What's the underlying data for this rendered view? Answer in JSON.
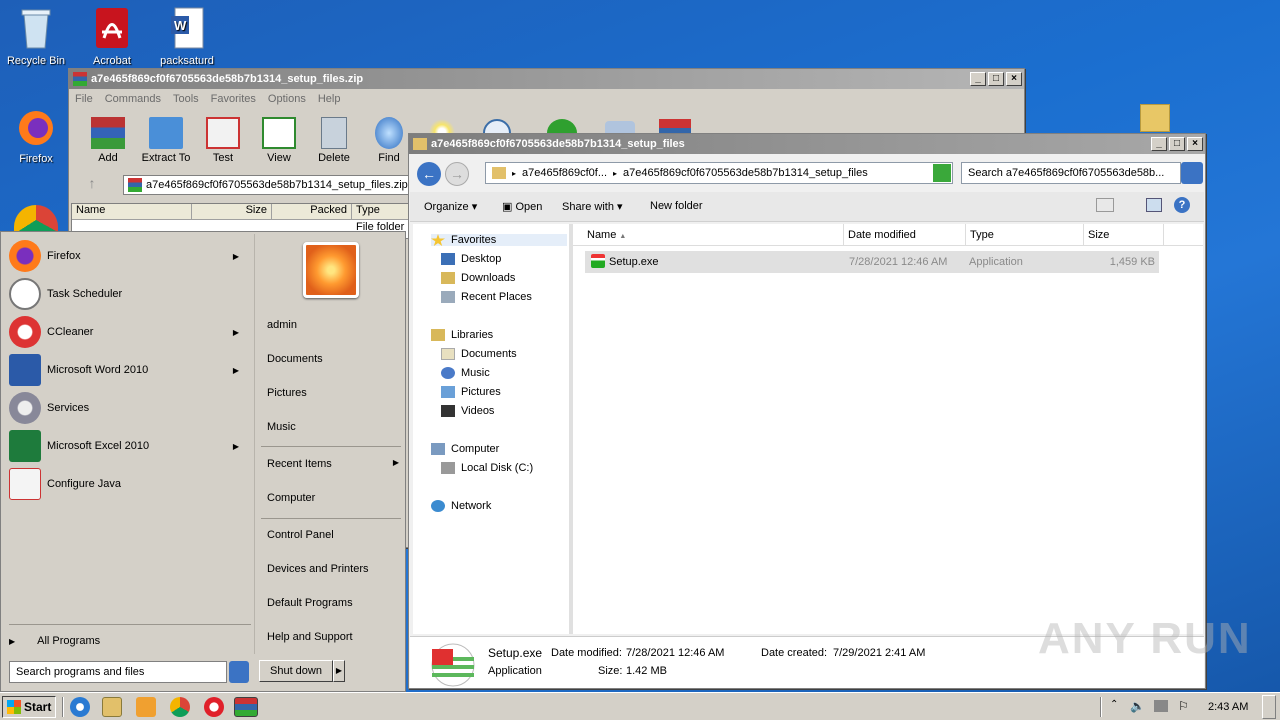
{
  "desktop": {
    "icons": [
      {
        "label": "Recycle Bin"
      },
      {
        "label": "Acrobat"
      },
      {
        "label": "packsaturd"
      },
      {
        "label": "Firefox"
      }
    ]
  },
  "winrar": {
    "title": "a7e465f869cf0f6705563de58b7b1314_setup_files.zip",
    "menu": [
      "File",
      "Commands",
      "Tools",
      "Favorites",
      "Options",
      "Help"
    ],
    "toolbar": [
      "Add",
      "Extract To",
      "Test",
      "View",
      "Delete",
      "Find"
    ],
    "path": "a7e465f869cf0f6705563de58b7b1314_setup_files.zip",
    "columns": [
      "Name",
      "Size",
      "Packed",
      "Type"
    ],
    "row_type": "File folder"
  },
  "explorer": {
    "title": "a7e465f869cf0f6705563de58b7b1314_setup_files",
    "crumb1": "a7e465f869cf0f...",
    "crumb2": "a7e465f869cf0f6705563de58b7b1314_setup_files",
    "search_placeholder": "Search a7e465f869cf0f6705563de58b...",
    "commands": {
      "organize": "Organize",
      "open": "Open",
      "share": "Share with",
      "new_folder": "New folder"
    },
    "nav": {
      "favorites": "Favorites",
      "desktop": "Desktop",
      "downloads": "Downloads",
      "recent": "Recent Places",
      "libraries": "Libraries",
      "documents": "Documents",
      "music": "Music",
      "pictures": "Pictures",
      "videos": "Videos",
      "computer": "Computer",
      "localdisk": "Local Disk (C:)",
      "network": "Network"
    },
    "columns": {
      "name": "Name",
      "date": "Date modified",
      "type": "Type",
      "size": "Size"
    },
    "file": {
      "name": "Setup.exe",
      "date": "7/28/2021 12:46 AM",
      "type": "Application",
      "size": "1,459 KB"
    },
    "details": {
      "name": "Setup.exe",
      "kind": "Application",
      "modified_label": "Date modified:",
      "modified": "7/28/2021 12:46 AM",
      "created_label": "Date created:",
      "created": "7/29/2021 2:41 AM",
      "size_label": "Size:",
      "size": "1.42 MB"
    }
  },
  "start_menu": {
    "programs": [
      {
        "label": "Firefox"
      },
      {
        "label": "Task Scheduler"
      },
      {
        "label": "CCleaner"
      },
      {
        "label": "Microsoft Word 2010"
      },
      {
        "label": "Services"
      },
      {
        "label": "Microsoft Excel 2010"
      },
      {
        "label": "Configure Java"
      }
    ],
    "all_programs": "All Programs",
    "search_placeholder": "Search programs and files",
    "right": {
      "admin": "admin",
      "documents": "Documents",
      "pictures": "Pictures",
      "music": "Music",
      "recent": "Recent Items",
      "computer": "Computer",
      "control": "Control Panel",
      "devices": "Devices and Printers",
      "defaults": "Default Programs",
      "help": "Help and Support"
    },
    "shutdown": "Shut down"
  },
  "taskbar": {
    "start": "Start",
    "clock": "2:43 AM"
  },
  "watermark": "ANY RUN"
}
